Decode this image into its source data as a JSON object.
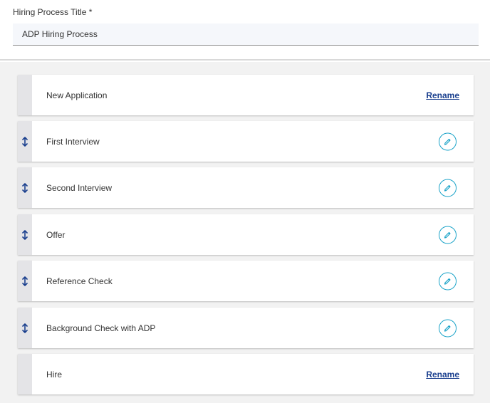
{
  "form": {
    "title_label": "Hiring Process Title *",
    "title_value": "ADP Hiring Process"
  },
  "stages": [
    {
      "name": "New Application",
      "draggable": false,
      "action": "Rename"
    },
    {
      "name": "First Interview",
      "draggable": true,
      "action": "edit"
    },
    {
      "name": "Second Interview",
      "draggable": true,
      "action": "edit"
    },
    {
      "name": "Offer",
      "draggable": true,
      "action": "edit"
    },
    {
      "name": "Reference Check",
      "draggable": true,
      "action": "edit"
    },
    {
      "name": "Background Check with ADP",
      "draggable": true,
      "action": "edit"
    },
    {
      "name": "Hire",
      "draggable": false,
      "action": "Rename"
    }
  ],
  "icons": {
    "drag": "drag-handle-icon",
    "edit": "pencil-icon"
  },
  "colors": {
    "link": "#1a3f8e",
    "drag_icon": "#1a3f8e",
    "edit_icon": "#1aa3c8",
    "list_background": "#f2f2f2",
    "handle_background": "#e4e4e7"
  }
}
